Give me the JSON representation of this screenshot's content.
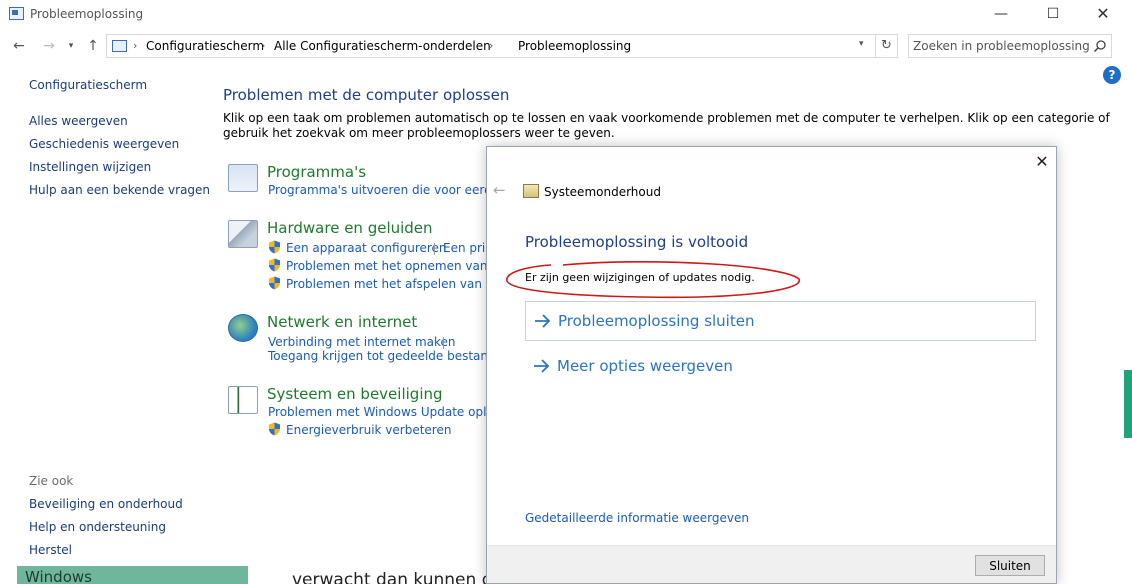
{
  "window": {
    "title": "Probleemoplossing",
    "minimize_glyph": "—",
    "maximize_glyph": "☐",
    "close_glyph": "✕"
  },
  "nav": {
    "back_glyph": "←",
    "forward_glyph": "→",
    "history_glyph": "▾",
    "up_glyph": "↑",
    "breadcrumbs": [
      "Configuratiescherm",
      "Alle Configuratiescherm-onderdelen",
      "Probleemoplossing"
    ],
    "breadcrumb_separator": "›",
    "address_dropdown_glyph": "▾",
    "refresh_glyph": "↻",
    "search_placeholder": "Zoeken in probleemoplossingen"
  },
  "help_glyph": "?",
  "left_pane": {
    "home": "Configuratiescherm",
    "links": [
      "Alles weergeven",
      "Geschiedenis weergeven",
      "Instellingen wijzigen",
      "Hulp aan een bekende vragen"
    ],
    "see_also_title": "Zie ook",
    "see_also": [
      "Beveiliging en onderhoud",
      "Help en ondersteuning",
      "Herstel"
    ],
    "bottom_label": "Windows"
  },
  "main": {
    "title": "Problemen met de computer oplossen",
    "description": "Klik op een taak om problemen automatisch op te lossen en vaak voorkomende problemen met de computer te verhelpen. Klik op een categorie of gebruik het zoekvak om meer probleemoplossers weer te geven.",
    "categories": [
      {
        "title": "Programma's",
        "links": [
          "Programma's uitvoeren die voor eerdere v"
        ]
      },
      {
        "title": "Hardware en geluiden",
        "links": [
          "Een apparaat configureren",
          "Een prin",
          "Problemen met het opnemen van audi",
          "Problemen met het afspelen van audi"
        ]
      },
      {
        "title": "Netwerk en internet",
        "links": [
          "Verbinding met internet maken",
          "Toegang krijgen tot gedeelde bestanden e"
        ]
      },
      {
        "title": "Systeem en beveiliging",
        "links": [
          "Problemen met Windows Update oplosse",
          "Energieverbruik verbeteren"
        ]
      }
    ],
    "bottom_partial_text": "verwacht dan kunnen d"
  },
  "dialog": {
    "close_glyph": "✕",
    "back_glyph": "←",
    "header_title": "Systeemonderhoud",
    "heading": "Probleemoplossing is voltooid",
    "message": "Er zijn geen wijzigingen of updates nodig.",
    "commands": [
      "Probleemoplossing sluiten",
      "Meer opties weergeven"
    ],
    "details_link": "Gedetailleerde informatie weergeven",
    "close_button": "Sluiten"
  },
  "colors": {
    "link": "#1a5bb8",
    "heading": "#1e3f8c",
    "category_title": "#1f7a2e",
    "annotation": "#d01818",
    "command": "#2b74c4"
  }
}
